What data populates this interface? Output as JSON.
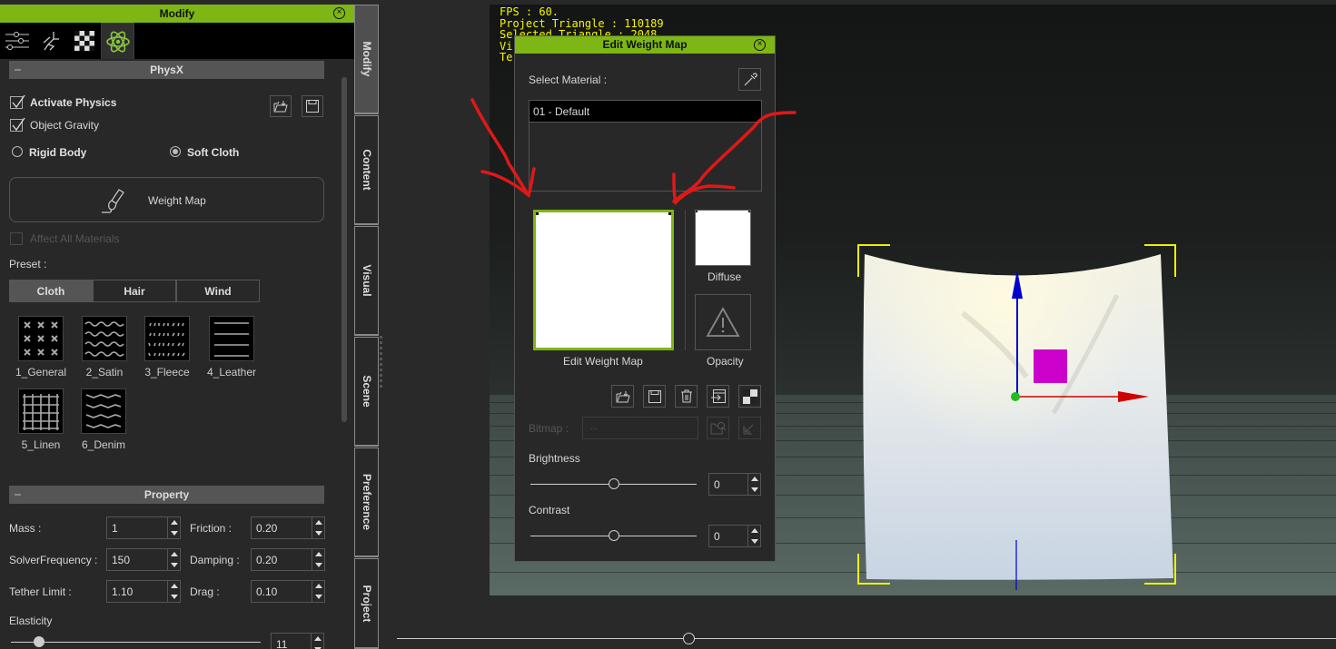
{
  "modify_panel": {
    "title": "Modify",
    "tool_tabs": [
      {
        "icon": "sliders-icon",
        "active": false
      },
      {
        "icon": "motion-icon",
        "active": false
      },
      {
        "icon": "checker-material-icon",
        "active": false
      },
      {
        "icon": "atom-physics-icon",
        "active": true
      }
    ],
    "physx": {
      "section_title": "PhysX",
      "activate_physics": {
        "label": "Activate Physics",
        "checked": true
      },
      "object_gravity": {
        "label": "Object Gravity",
        "checked": true
      },
      "body_type": {
        "options": [
          {
            "label": "Rigid Body",
            "selected": false
          },
          {
            "label": "Soft Cloth",
            "selected": true
          }
        ]
      },
      "weight_map_button": "Weight Map",
      "affect_all_materials": {
        "label": "Affect All Materials",
        "checked": false,
        "enabled": false
      },
      "preset_label": "Preset :",
      "preset_tabs": [
        {
          "label": "Cloth",
          "active": true
        },
        {
          "label": "Hair",
          "active": false
        },
        {
          "label": "Wind",
          "active": false
        }
      ],
      "presets": [
        {
          "name": "1_General",
          "pattern": "crosses"
        },
        {
          "name": "2_Satin",
          "pattern": "waves"
        },
        {
          "name": "3_Fleece",
          "pattern": "dashes"
        },
        {
          "name": "4_Leather",
          "pattern": "lines"
        },
        {
          "name": "5_Linen",
          "pattern": "grid"
        },
        {
          "name": "6_Denim",
          "pattern": "zigzag"
        }
      ]
    },
    "property": {
      "section_title": "Property",
      "fields": [
        {
          "label": "Mass :",
          "value": "1"
        },
        {
          "label": "Friction :",
          "value": "0.20"
        },
        {
          "label": "SolverFrequency :",
          "value": "150"
        },
        {
          "label": "Damping :",
          "value": "0.20"
        },
        {
          "label": "Tether Limit :",
          "value": "1.10"
        },
        {
          "label": "Drag :",
          "value": "0.10"
        }
      ],
      "elasticity": {
        "label": "Elasticity",
        "value": "11"
      }
    }
  },
  "side_tabs": [
    {
      "label": "Modify",
      "active": true
    },
    {
      "label": "Content",
      "active": false
    },
    {
      "label": "Visual",
      "active": false
    },
    {
      "label": "Scene",
      "active": false
    },
    {
      "label": "Preference",
      "active": false
    },
    {
      "label": "Project",
      "active": false
    }
  ],
  "viewport": {
    "stats": [
      "FPS : 60.",
      "Project Triangle : 110189",
      "Selected Triangle : 2048",
      "Vi",
      "Te"
    ],
    "colors": {
      "stats_text": "#f6f600",
      "gizmo_x": "#d00000",
      "gizmo_z": "#0000d0",
      "gizmo_center": "#22bb22",
      "selection_bracket": "#f0f000",
      "pivot_marker": "#cc00cc"
    }
  },
  "edit_weight_map": {
    "title": "Edit Weight Map",
    "select_material_label": "Select Material :",
    "materials": [
      "01 - Default"
    ],
    "weight_map_caption": "Edit Weight Map",
    "diffuse_caption": "Diffuse",
    "opacity_caption": "Opacity",
    "toolbar": [
      {
        "icon": "load-folder-icon",
        "enabled": true
      },
      {
        "icon": "save-icon",
        "enabled": true
      },
      {
        "icon": "trash-icon",
        "enabled": true
      },
      {
        "icon": "import-icon",
        "enabled": true
      },
      {
        "icon": "checker-icon",
        "enabled": true
      }
    ],
    "bitmap": {
      "label": "Bitmap :",
      "value": "...",
      "enabled": false
    },
    "brightness": {
      "label": "Brightness",
      "value": "0",
      "fraction": 0.5
    },
    "contrast": {
      "label": "Contrast",
      "value": "0",
      "fraction": 0.5
    }
  },
  "accent_color": "#7db615",
  "timeline": {
    "fraction": 0.31
  }
}
